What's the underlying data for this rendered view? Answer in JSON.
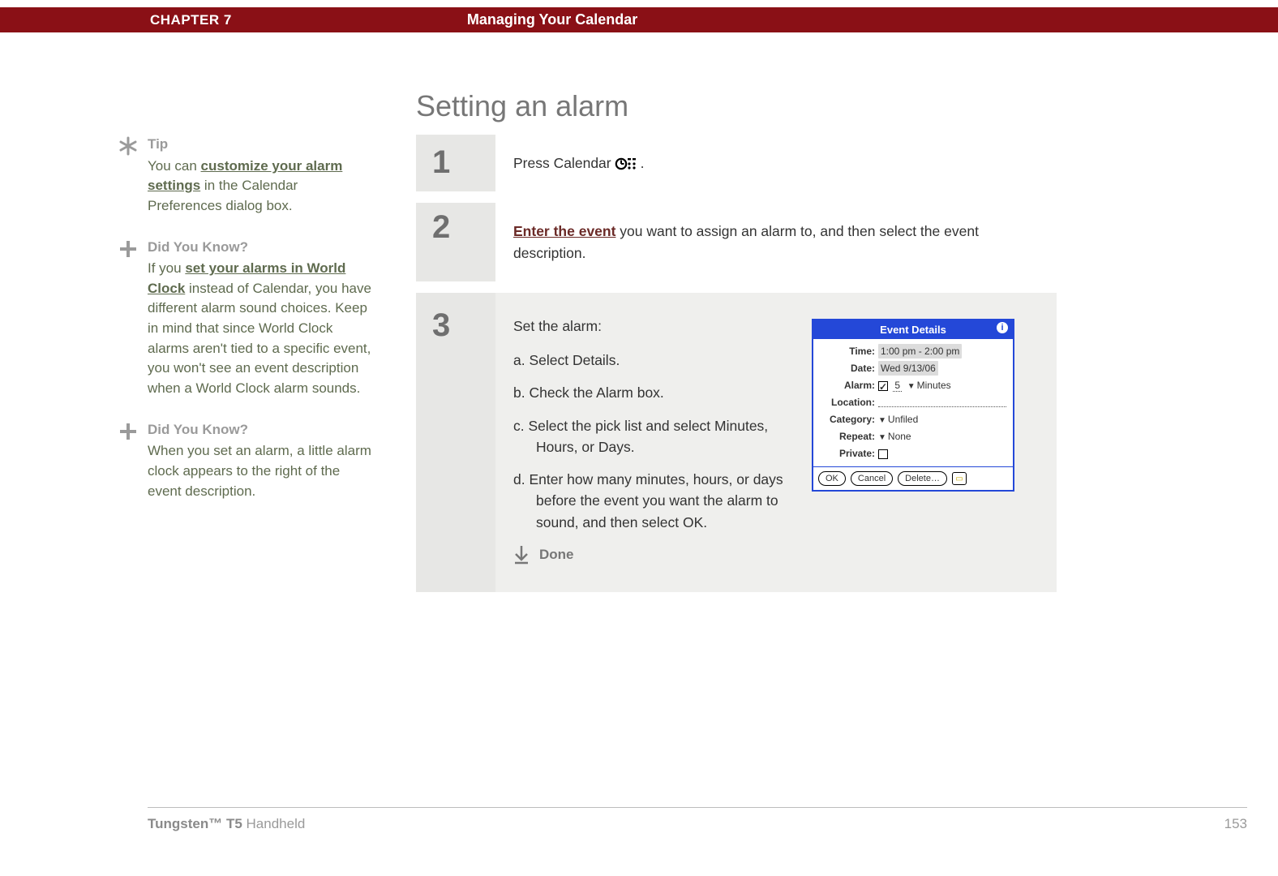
{
  "header": {
    "chapter": "CHAPTER 7",
    "title": "Managing Your Calendar"
  },
  "heading": "Setting an alarm",
  "sidebar": {
    "tip": {
      "head": "Tip",
      "pre": "You can ",
      "link": "customize your alarm settings",
      "post": " in the Calendar Preferences dialog box."
    },
    "dyk1": {
      "head": "Did You Know?",
      "pre": "If you ",
      "link": "set your alarms in World Clock",
      "post": " instead of Calendar, you have different alarm sound choices. Keep in mind that since World Clock alarms aren't tied to a specific event, you won't see an event description when a World Clock alarm sounds."
    },
    "dyk2": {
      "head": "Did You Know?",
      "body": "When you set an alarm, a little alarm clock appears to the right of the event description."
    }
  },
  "steps": {
    "s1": {
      "num": "1",
      "pre": "Press Calendar ",
      "post": "."
    },
    "s2": {
      "num": "2",
      "link": "Enter the event",
      "post": " you want to assign an alarm to, and then select the event description."
    },
    "s3": {
      "num": "3",
      "intro": "Set the alarm:",
      "a": "a.  Select Details.",
      "b": "b.  Check the Alarm box.",
      "c": "c.  Select the pick list and select Minutes, Hours, or Days.",
      "d": "d.  Enter how many minutes, hours, or days before the event you want the alarm to sound, and then select OK.",
      "done": "Done"
    }
  },
  "event": {
    "title": "Event Details",
    "time_label": "Time:",
    "time_value": "1:00 pm - 2:00 pm",
    "date_label": "Date:",
    "date_value": "Wed 9/13/06",
    "alarm_label": "Alarm:",
    "alarm_count": "5",
    "alarm_unit": "Minutes",
    "location_label": "Location:",
    "category_label": "Category:",
    "category_value": "Unfiled",
    "repeat_label": "Repeat:",
    "repeat_value": "None",
    "private_label": "Private:",
    "ok": "OK",
    "cancel": "Cancel",
    "delete": "Delete…"
  },
  "footer": {
    "product_bold": "Tungsten™ T5",
    "product_rest": " Handheld",
    "page": "153"
  }
}
